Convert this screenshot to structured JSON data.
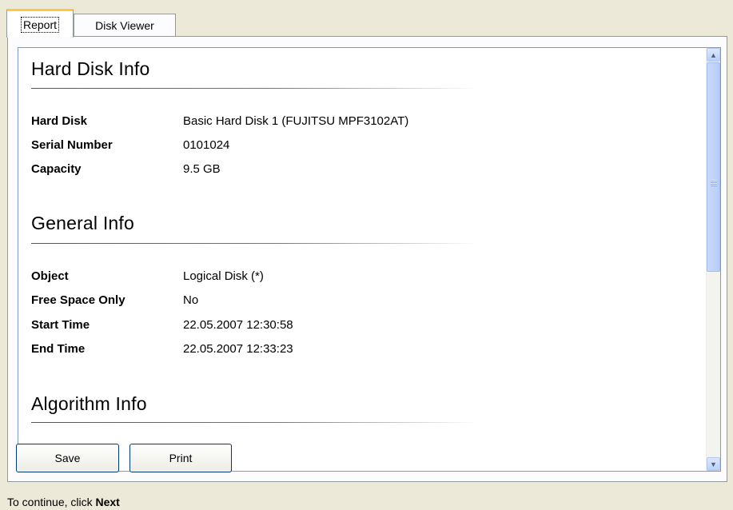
{
  "tabs": [
    {
      "label": "Report",
      "active": true
    },
    {
      "label": "Disk Viewer",
      "active": false
    }
  ],
  "report": {
    "sections": [
      {
        "title": "Hard Disk Info",
        "rows": [
          {
            "label": "Hard Disk",
            "value": "Basic Hard Disk 1 (FUJITSU MPF3102AT)"
          },
          {
            "label": "Serial Number",
            "value": "0101024"
          },
          {
            "label": "Capacity",
            "value": "9.5 GB"
          }
        ]
      },
      {
        "title": "General Info",
        "rows": [
          {
            "label": "Object",
            "value": "Logical Disk (*)"
          },
          {
            "label": "Free Space Only",
            "value": "No"
          },
          {
            "label": "Start Time",
            "value": "22.05.2007 12:30:58"
          },
          {
            "label": "End Time",
            "value": "22.05.2007 12:33:23"
          }
        ]
      },
      {
        "title": "Algorithm Info",
        "rows": []
      }
    ]
  },
  "buttons": {
    "save_label": "Save",
    "print_label": "Print"
  },
  "status": {
    "prefix": "To continue, click ",
    "emphasis": "Next"
  },
  "colors": {
    "window_bg": "#ECE9D8",
    "active_tab_accent": "#FFC83C",
    "button_border": "#003C74",
    "scrollbar_thumb": "#B7CCF6"
  },
  "icons": {
    "scroll_up": "chevron-up-icon",
    "scroll_down": "chevron-down-icon"
  }
}
